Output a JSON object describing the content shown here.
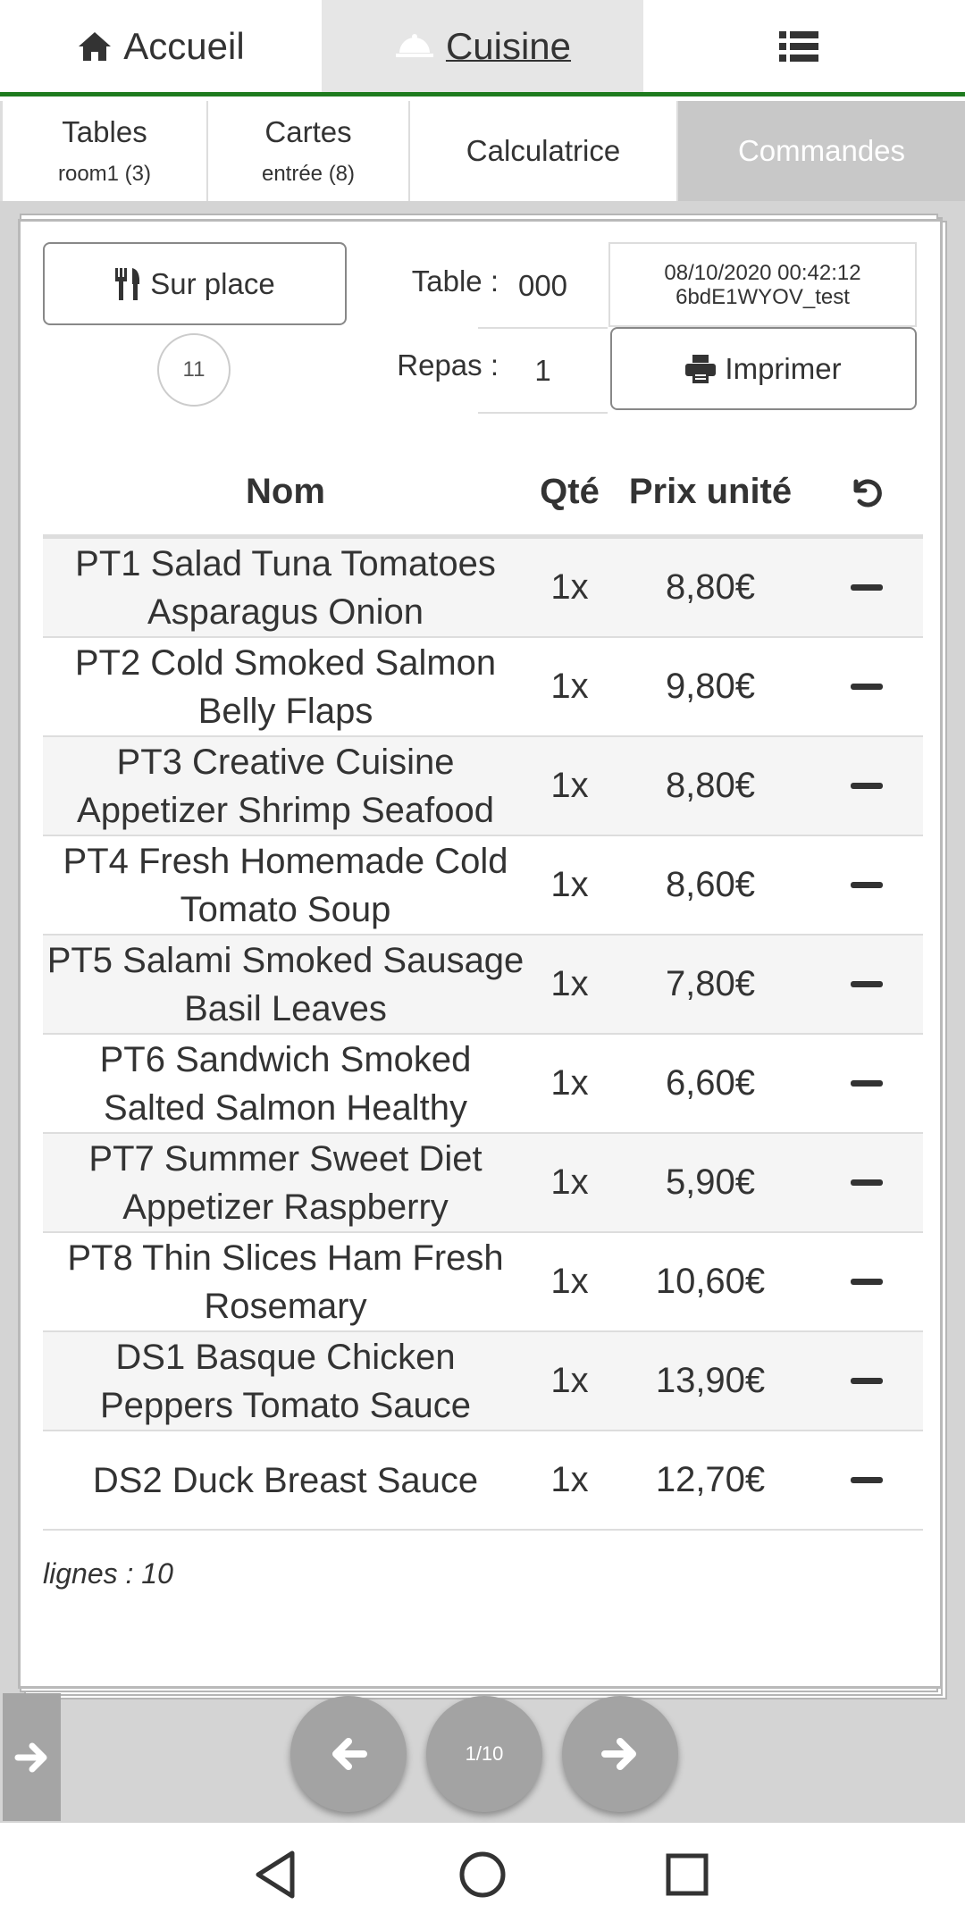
{
  "topnav": {
    "home_label": "Accueil",
    "cuisine_label": "Cuisine",
    "home_icon": "home-icon",
    "cuisine_icon": "serving-dish-icon",
    "menu_icon": "list-icon"
  },
  "subtabs": {
    "tables_title": "Tables",
    "tables_sub": "room1 (3)",
    "cartes_title": "Cartes",
    "cartes_sub": "entrée (8)",
    "calc_label": "Calculatrice",
    "cmd_label": "Commandes"
  },
  "order": {
    "sur_place_label": "Sur place",
    "badge_count": "11",
    "table_label": "Table :",
    "table_value": "000",
    "repas_label": "Repas :",
    "repas_value": "1",
    "datetime": "08/10/2020 00:42:12",
    "order_id": "6bdE1WYOV_test",
    "print_label": "Imprimer"
  },
  "table": {
    "headers": {
      "nom": "Nom",
      "qte": "Qté",
      "prix": "Prix unité"
    },
    "rows": [
      {
        "nom": "PT1 Salad Tuna Tomatoes Asparagus Onion",
        "qte": "1x",
        "prix": "8,80€"
      },
      {
        "nom": "PT2 Cold Smoked Salmon Belly Flaps",
        "qte": "1x",
        "prix": "9,80€"
      },
      {
        "nom": "PT3 Creative Cuisine Appetizer Shrimp Seafood",
        "qte": "1x",
        "prix": "8,80€"
      },
      {
        "nom": "PT4 Fresh Homemade Cold Tomato Soup",
        "qte": "1x",
        "prix": "8,60€"
      },
      {
        "nom": "PT5 Salami Smoked Sausage Basil Leaves",
        "qte": "1x",
        "prix": "7,80€"
      },
      {
        "nom": "PT6 Sandwich Smoked Salted Salmon Healthy",
        "qte": "1x",
        "prix": "6,60€"
      },
      {
        "nom": "PT7 Summer Sweet Diet Appetizer Raspberry",
        "qte": "1x",
        "prix": "5,90€"
      },
      {
        "nom": "PT8 Thin Slices Ham Fresh Rosemary",
        "qte": "1x",
        "prix": "10,60€"
      },
      {
        "nom": "DS1 Basque Chicken Peppers Tomato Sauce",
        "qte": "1x",
        "prix": "13,90€"
      },
      {
        "nom": "DS2 Duck Breast Sauce",
        "qte": "1x",
        "prix": "12,70€"
      }
    ],
    "footer": "lignes : 10"
  },
  "pager": {
    "page_label": "1/10"
  },
  "colors": {
    "accent_green": "#1e7b1e",
    "button_gray": "#a3a3a3"
  }
}
